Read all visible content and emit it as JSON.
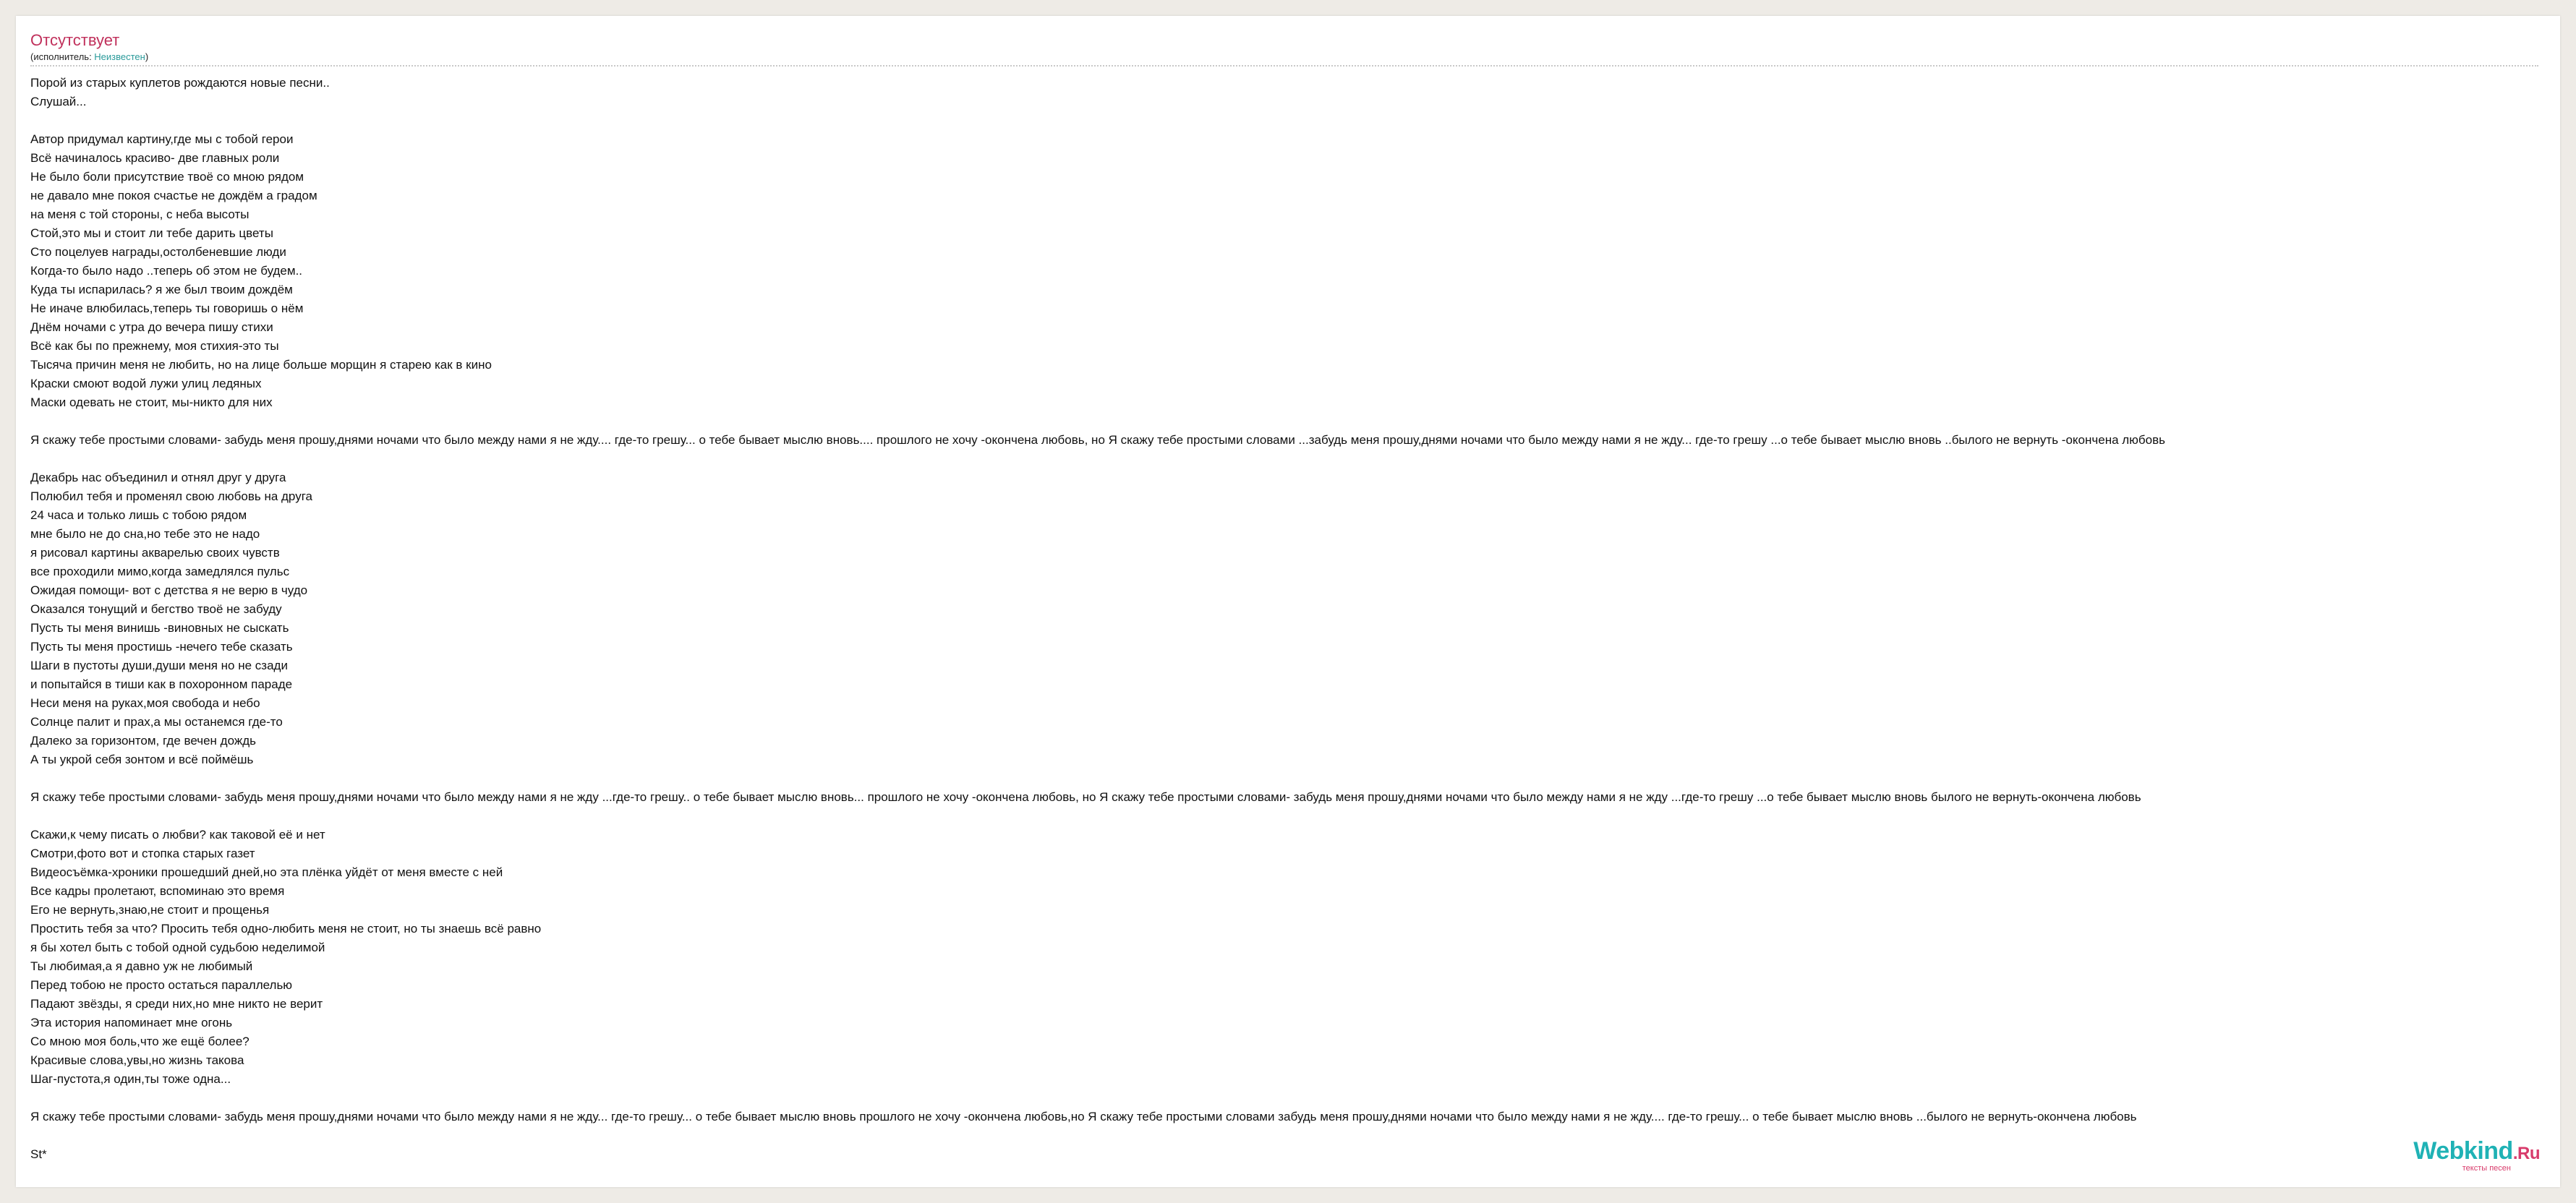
{
  "song": {
    "title": "Отсутствует",
    "performer_prefix": "(исполнитель: ",
    "performer_name": "Неизвестен",
    "performer_suffix": ")"
  },
  "lyrics": "Порой из старых куплетов рождаются новые песни..\nСлушай...\n\nАвтор придумал картину,где мы с тобой герои\nВсё начиналось красиво- две главных роли\nНе было боли присутствие твоё со мною рядом\nне давало мне покоя счастье не дождём а градом\nна меня с той стороны, с неба высоты\nСтой,это мы и стоит ли тебе дарить цветы\nСто поцелуев награды,остолбеневшие люди\nКогда-то было надо ..теперь об этом не будем..\nКуда ты испарилась? я же был твоим дождём\nНе иначе влюбилась,теперь ты говоришь о нём\nДнём ночами с утра до вечера пишу стихи\nВсё как бы по прежнему, моя стихия-это ты\nТысяча причин меня не любить, но на лице больше морщин я старею как в кино\nКраски смоют водой лужи улиц ледяных\nМаски одевать не стоит, мы-никто для них\n\nЯ скажу тебе простыми словами- забудь меня прошу,днями ночами что было между нами я не жду.... где-то грешу... о тебе бывает мыслю вновь.... прошлого не хочу -окончена любовь, но Я скажу тебе простыми словами ...забудь меня прошу,днями ночами что было между нами я не жду... где-то грешу ...о тебе бывает мыслю вновь ..былого не вернуть -окончена любовь\n\nДекабрь нас объединил и отнял друг у друга\nПолюбил тебя и променял свою любовь на друга\n24 часа и только лишь с тобою рядом\nмне было не до сна,но тебе это не надо\nя рисовал картины акварелью своих чувств\nвсе проходили мимо,когда замедлялся пульс\nОжидая помощи- вот с детства я не верю в чудо\nОказался тонущий и бегство твоё не забуду\nПусть ты меня винишь -виновных не сыскать\nПусть ты меня простишь -нечего тебе сказать\nШаги в пустоты души,души меня но не сзади\nи попытайся в тиши как в похоронном параде\nНеси меня на руках,моя свобода и небо\nСолнце палит и прах,а мы останемся где-то\nДалеко за горизонтом, где вечен дождь\nА ты укрой себя зонтом и всё поймёшь\n\nЯ скажу тебе простыми словами- забудь меня прошу,днями ночами что было между нами я не жду ...где-то грешу.. о тебе бывает мыслю вновь... прошлого не хочу -окончена любовь, но Я скажу тебе простыми словами- забудь меня прошу,днями ночами что было между нами я не жду ...где-то грешу ...о тебе бывает мыслю вновь былого не вернуть-окончена любовь\n\nСкажи,к чему писать о любви? как таковой её и нет\nСмотри,фото вот и стопка старых газет\nВидеосъёмка-хроники прошедший дней,но эта плёнка уйдёт от меня вместе с ней\nВсе кадры пролетают, вспоминаю это время\nЕго не вернуть,знаю,не стоит и прощенья\nПростить тебя за что? Просить тебя одно-любить меня не стоит, но ты знаешь всё равно\nя бы хотел быть с тобой одной судьбою неделимой\nТы любимая,а я давно уж не любимый\nПеред тобою не просто остаться параллелью\nПадают звёзды, я среди них,но мне никто не верит\nЭта история напоминает мне огонь\nСо мною моя боль,что же ещё более?\nКрасивые слова,увы,но жизнь такова\nШаг-пустота,я один,ты тоже одна...\n\nЯ скажу тебе простыми словами- забудь меня прошу,днями ночами что было между нами я не жду... где-то грешу... о тебе бывает мыслю вновь прошлого не хочу -окончена любовь,но Я скажу тебе простыми словами забудь меня прошу,днями ночами что было между нами я не жду.... где-то грешу... о тебе бывает мыслю вновь ...былого не вернуть-окончена любовь\n\nSt*",
  "logo": {
    "name": "Webkind",
    "tld": ".Ru",
    "tagline": "тексты песен"
  },
  "colors": {
    "title": "#c0305b",
    "link": "#2a9a9a",
    "logo_primary": "#1fb2b5",
    "logo_accent": "#d83b6b",
    "page_background": "#eeebe6"
  }
}
